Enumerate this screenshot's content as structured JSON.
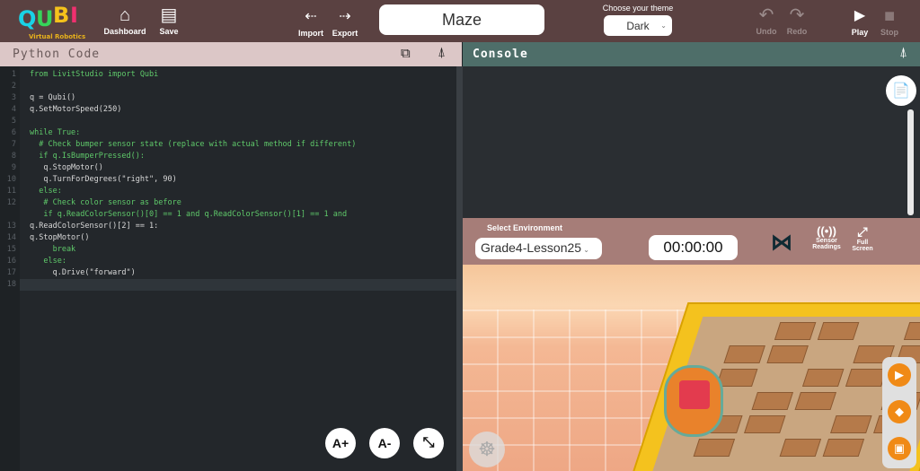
{
  "logo": {
    "text": "QUBI",
    "subtitle": "Virtual Robotics"
  },
  "toolbar": {
    "dashboard": "Dashboard",
    "save": "Save",
    "import": "Import",
    "export": "Export",
    "title": "Maze",
    "theme_label": "Choose your theme",
    "theme_value": "Dark",
    "undo": "Undo",
    "redo": "Redo",
    "play": "Play",
    "stop": "Stop"
  },
  "editor": {
    "title": "Python Code",
    "line_numbers": [
      "1",
      "2",
      "3",
      "4",
      "5",
      "6",
      "7",
      "8",
      "9",
      "10",
      "11",
      "12",
      "",
      "13",
      "14",
      "15",
      "16",
      "17",
      "18"
    ],
    "lines": [
      "from LivitStudio import Qubi",
      "",
      "q = Qubi()",
      "q.SetMotorSpeed(250)",
      "",
      "while True:",
      "  # Check bumper sensor state (replace with actual method if different)",
      "  if q.IsBumperPressed():",
      "   q.StopMotor()",
      "   q.TurnForDegrees(\"right\", 90)",
      "  else:",
      "   # Check color sensor as before",
      "   if q.ReadColorSensor()[0] == 1 and q.ReadColorSensor()[1] == 1 and",
      "q.ReadColorSensor()[2] == 1:",
      "q.StopMotor()",
      "     break",
      "   else:",
      "     q.Drive(\"forward\")",
      ""
    ],
    "font_increase": "A+",
    "font_decrease": "A-"
  },
  "console": {
    "title": "Console"
  },
  "environment": {
    "label": "Select Environment",
    "selected": "Grade4-Lesson25",
    "timer": "00:00:00",
    "sensor_readings": "Sensor Readings",
    "full_screen": "Full Screen"
  },
  "colors": {
    "topbar": "#5a4141",
    "code_header": "#dcc7c7",
    "console_header": "#4e6e69",
    "env_bar": "#a67d78",
    "accent_orange": "#f08a16"
  }
}
